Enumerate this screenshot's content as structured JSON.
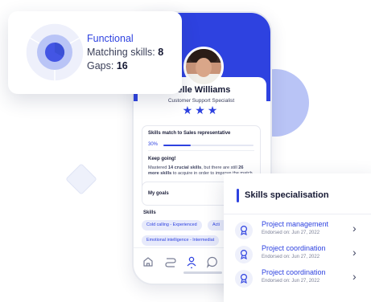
{
  "profile": {
    "name": "nelle Williams",
    "role": "Customer Support Specialist",
    "stars": "★★★"
  },
  "match": {
    "title": "Skills match to Sales representative",
    "percent_label": "30%",
    "progress": 0.3,
    "keep_going": "Keep going!",
    "desc_pre": "Mastered ",
    "desc_bold1": "14 crucial skills",
    "desc_mid": ", but there are still ",
    "desc_bold2": "26 more skills",
    "desc_post": " to acquire in order to improve the match."
  },
  "goals": {
    "label": "My goals"
  },
  "skills": {
    "label": "Skills",
    "chips": [
      "Cold calling - Experienced",
      "Acti",
      "Emotional intelligence - Intermediat"
    ]
  },
  "nav": {
    "items": [
      "home-icon",
      "route-icon",
      "person-icon",
      "chat-icon",
      "send-icon"
    ]
  },
  "functional": {
    "title": "Functional",
    "matching_label": "Matching skills: ",
    "matching_value": "8",
    "gaps_label": "Gaps: ",
    "gaps_value": "16"
  },
  "specialisation": {
    "title": "Skills specialisation",
    "items": [
      {
        "name": "Project management",
        "endorsed": "Endorsed on: Jun 27, 2022"
      },
      {
        "name": "Project coordination",
        "endorsed": "Endorsed on: Jun 27, 2022"
      },
      {
        "name": "Project coordination",
        "endorsed": "Endorsed on: Jun 27, 2022"
      }
    ]
  },
  "colors": {
    "accent": "#2e42e0",
    "chip_bg": "#e7eafb",
    "deco": "#b9c4f6"
  }
}
